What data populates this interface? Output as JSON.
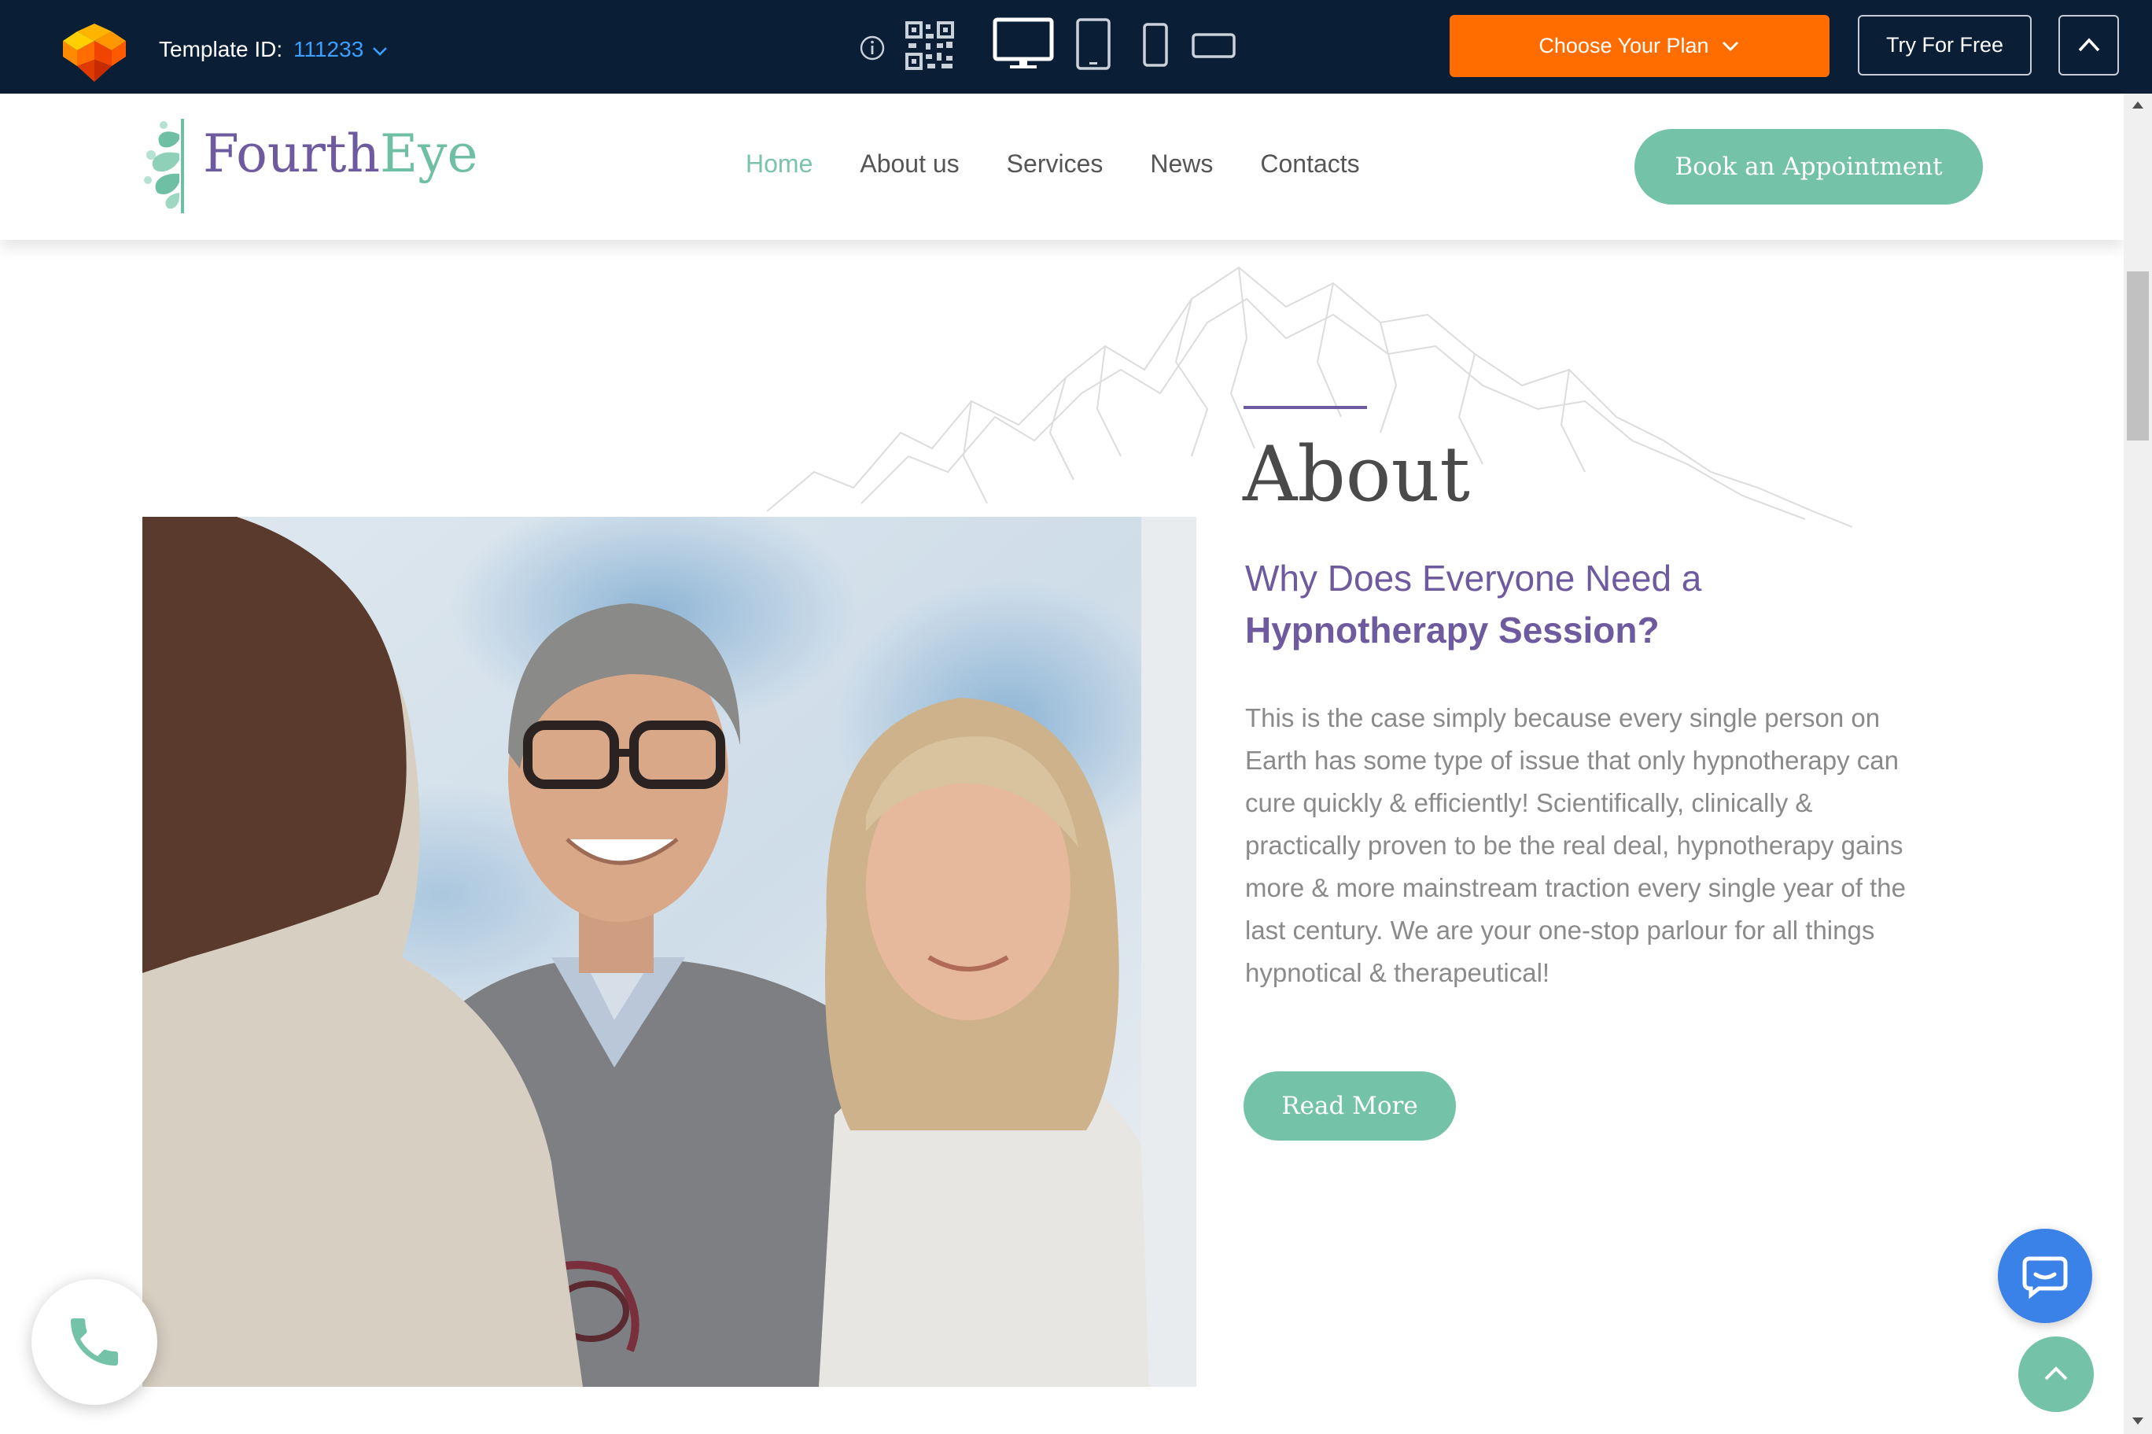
{
  "toolbar": {
    "template_id_label": "Template ID:",
    "template_id_value": "111233",
    "icons": [
      "info-icon",
      "qr-code-icon",
      "desktop-icon",
      "tablet-icon",
      "mobile-icon",
      "mobile-landscape-icon"
    ],
    "choose_plan_label": "Choose Your Plan",
    "try_free_label": "Try For Free",
    "colors": {
      "bar": "#0a1e36",
      "choose_plan": "#ff6d00",
      "link": "#3aa0ff"
    }
  },
  "site": {
    "brand": {
      "part1": "Fourth",
      "part2": "Eye"
    },
    "nav": [
      {
        "label": "Home",
        "active": true
      },
      {
        "label": "About us",
        "active": false
      },
      {
        "label": "Services",
        "active": false
      },
      {
        "label": "News",
        "active": false
      },
      {
        "label": "Contacts",
        "active": false
      }
    ],
    "book_label": "Book an Appointment",
    "colors": {
      "accent_green": "#74c2a7",
      "accent_purple": "#6e5a9e"
    }
  },
  "about": {
    "title": "About",
    "subtitle_line1": "Why Does Everyone Need a",
    "subtitle_line2": "Hypnotherapy Session?",
    "body": "This is the case simply because every single person on Earth has some type of issue that only hypnotherapy can cure quickly & efficiently! Scientifically, clinically & practically proven to be the real deal, hypnotherapy gains more & more mainstream traction every single year of the last century. We are your one-stop parlour for all things hypnotical & therapeutical!",
    "read_more_label": "Read More"
  },
  "widgets": {
    "phone_icon": "phone-icon",
    "chat_icon": "chat-icon",
    "scroll_top_icon": "chevron-up-icon"
  }
}
